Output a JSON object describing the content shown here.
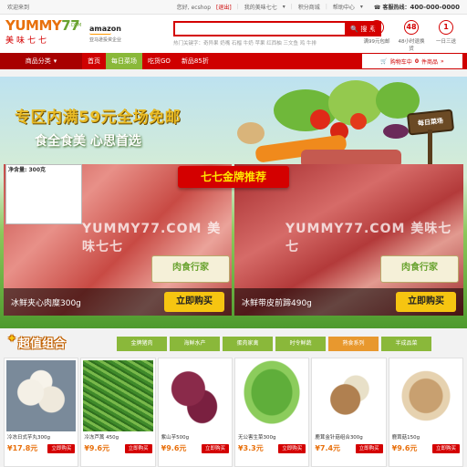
{
  "topbar": {
    "welcome": "欢迎来到",
    "greeting": "您好, ecshop",
    "logout": "[退出]",
    "my_account": "我的美味七七",
    "points_mall": "积分商城",
    "help": "帮助中心",
    "hotline_label": "客服热线：",
    "hotline_number": "400-000-0000"
  },
  "header": {
    "logo_en_a": "YUMMY",
    "logo_en_b": "77",
    "logo_com": ".COM",
    "logo_cn": "美味七七",
    "partner_brand": "amazon",
    "partner_text": "亚马逊投资企业",
    "search_placeholder": "",
    "search_button": "搜 索",
    "hot_keywords": "热门关键字：奇异果  奶嘴  石榴  牛奶  苹果  红西柚  三文鱼  鸡  牛排",
    "promises": [
      {
        "icon": "满",
        "label": "满99元包邮"
      },
      {
        "icon": "48",
        "label": "48小时退换货"
      },
      {
        "icon": "1",
        "label": "一日三送"
      }
    ]
  },
  "nav": {
    "category": "商品分类",
    "items": [
      "首页",
      "每日菜场",
      "吃货GO",
      "新品85折"
    ],
    "active_index": 1,
    "cart_text": "购物车中",
    "cart_count": "0",
    "cart_unit": "件商品"
  },
  "banner": {
    "headline": "专区内满59元全场免邮",
    "subline": "食全食美 心思首选",
    "sign": "每日菜场",
    "ribbon": "七七金牌推荐",
    "watermark": "YUMMY77.COM 美味七七",
    "promos": [
      {
        "name": "冰鲜夹心肉糜300g",
        "buy": "立即购买",
        "weight_label": "净含量: 300克",
        "pack": "肉食行家"
      },
      {
        "name": "冰鲜带皮前蹄490g",
        "buy": "立即购买",
        "pack": "肉食行家"
      }
    ]
  },
  "section": {
    "title": "超值组合",
    "tabs": [
      "金牌猪肉",
      "海鲜水产",
      "蛋肉家禽",
      "时令鲜蔬",
      "熟食系列",
      "半成品菜"
    ],
    "products": [
      {
        "name": "冷冻日式芋丸300g",
        "price": "¥17.8元",
        "buy": "立即购买"
      },
      {
        "name": "冷冻芦蒿 450g",
        "price": "¥9.6元",
        "buy": "立即购买"
      },
      {
        "name": "紫山芋500g",
        "price": "¥9.6元",
        "buy": "立即购买"
      },
      {
        "name": "无公害生菜300g",
        "price": "¥3.3元",
        "buy": "立即购买"
      },
      {
        "name": "鹿茸金针菇组合300g",
        "price": "¥7.4元",
        "buy": "立即购买"
      },
      {
        "name": "鹿茸菇150g",
        "price": "¥9.6元",
        "buy": "立即购买"
      }
    ]
  },
  "colors": {
    "brand_red": "#d40000",
    "accent_green": "#8ab83a",
    "accent_orange": "#e8700c",
    "buy_yellow": "#f6c511"
  }
}
